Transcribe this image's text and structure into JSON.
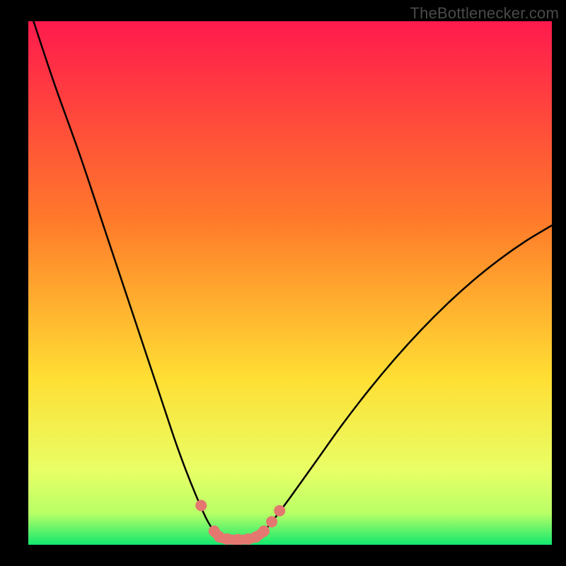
{
  "watermark": "TheBottlenecker.com",
  "chart_data": {
    "type": "line",
    "title": "",
    "xlabel": "",
    "ylabel": "",
    "xlim": [
      0,
      100
    ],
    "ylim": [
      0,
      100
    ],
    "background_gradient": {
      "top_color": "#ff1a4d",
      "mid_color": "#ffde33",
      "lower_color": "#e8ff66",
      "bottom_color": "#12e86e"
    },
    "series": [
      {
        "name": "left-branch",
        "color": "#000000",
        "x": [
          1,
          5,
          10,
          15,
          20,
          25,
          28,
          30,
          32,
          34,
          35.5
        ],
        "y": [
          100,
          88,
          74,
          59,
          44,
          29,
          20,
          14.5,
          9.5,
          5,
          2.5
        ]
      },
      {
        "name": "right-branch",
        "color": "#000000",
        "x": [
          45,
          47,
          50,
          55,
          60,
          65,
          70,
          75,
          80,
          85,
          90,
          95,
          100
        ],
        "y": [
          2.5,
          5,
          9,
          16,
          23,
          29.5,
          35.5,
          41,
          46,
          50.5,
          54.5,
          58,
          61
        ]
      },
      {
        "name": "valley-floor",
        "color": "#e4776f",
        "x": [
          35.5,
          37,
          39,
          41,
          43,
          45
        ],
        "y": [
          2.5,
          1.3,
          1,
          1,
          1.3,
          2.5
        ]
      }
    ],
    "markers": [
      {
        "name": "marker-left-upper",
        "x": 33,
        "y": 7.5
      },
      {
        "name": "marker-left-lower",
        "x": 35.5,
        "y": 2.6
      },
      {
        "name": "marker-floor-1",
        "x": 36.5,
        "y": 1.5
      },
      {
        "name": "marker-floor-2",
        "x": 38,
        "y": 1.1
      },
      {
        "name": "marker-floor-3",
        "x": 40,
        "y": 1.0
      },
      {
        "name": "marker-floor-4",
        "x": 42,
        "y": 1.1
      },
      {
        "name": "marker-floor-5",
        "x": 43.5,
        "y": 1.5
      },
      {
        "name": "marker-right-lower",
        "x": 45,
        "y": 2.6
      },
      {
        "name": "marker-right-mid",
        "x": 46.5,
        "y": 4.4
      },
      {
        "name": "marker-right-upper",
        "x": 48,
        "y": 6.5
      }
    ],
    "marker_color": "#e4776f",
    "marker_radius": 8
  }
}
